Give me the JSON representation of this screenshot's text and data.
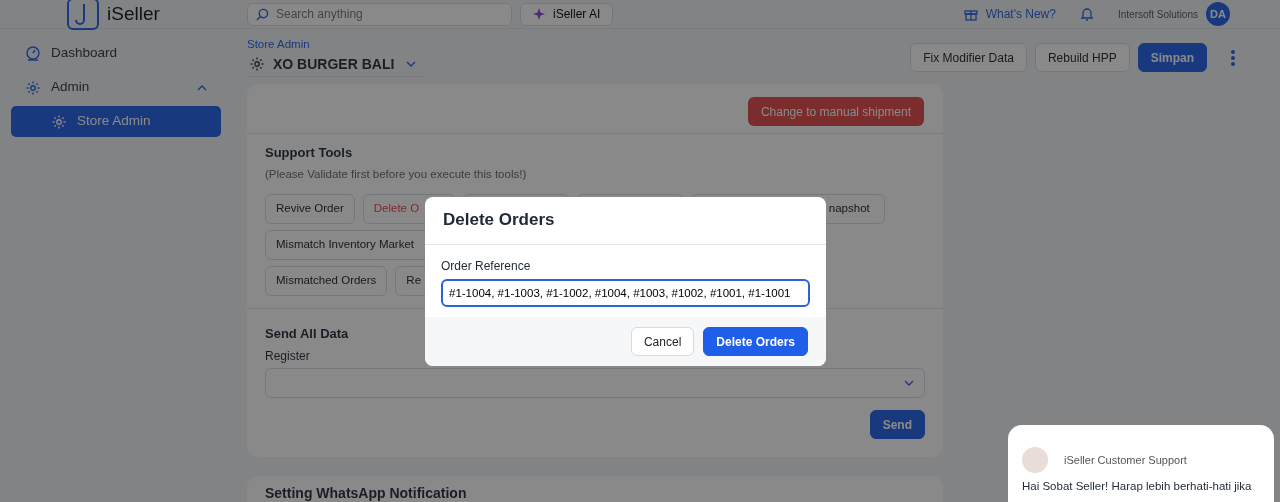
{
  "header": {
    "logo_text": "iSeller",
    "search": {
      "placeholder": "Search anything"
    },
    "ai_button": "iSeller AI",
    "whats_new": "What's New?",
    "company": "Intersoft Solutions",
    "avatar": "DA"
  },
  "sidebar": {
    "items": [
      {
        "label": "Dashboard",
        "kind": "dashboard",
        "selected": false
      },
      {
        "label": "Admin",
        "kind": "gear",
        "selected": false,
        "expanded": true,
        "children": [
          {
            "label": "Store Admin",
            "kind": "gear",
            "selected": true
          }
        ]
      }
    ]
  },
  "page": {
    "breadcrumb": "Store Admin",
    "store_name": "XO BURGER BALI",
    "actions": [
      {
        "label": "Fix Modifier Data",
        "kind": "secondary"
      },
      {
        "label": "Rebuild HPP",
        "kind": "secondary"
      },
      {
        "label": "Simpan",
        "kind": "primary"
      }
    ]
  },
  "shipment_button": "Change to manual shipment",
  "support_tools": {
    "title": "Support Tools",
    "note": "(Please Validate first before you execute this tools!)",
    "rows": [
      [
        {
          "kind": "full",
          "label": "Revive Order"
        },
        {
          "kind": "danger",
          "label": "Delete O"
        },
        {
          "kind": "covered"
        },
        {
          "kind": "covered"
        },
        {
          "kind": "tail",
          "label": "napshot"
        }
      ],
      [
        {
          "kind": "cut",
          "label": "Mismatch Inventory Market"
        }
      ],
      [
        {
          "kind": "full",
          "label": "Mismatched Orders"
        },
        {
          "kind": "cut",
          "label": "Re"
        }
      ]
    ]
  },
  "send_all_data": {
    "title": "Send All Data",
    "field_label": "Register",
    "button": "Send"
  },
  "next_card": {
    "title": "Setting WhatsApp Notification"
  },
  "modal": {
    "title": "Delete Orders",
    "field_label": "Order Reference",
    "value": "#1-1004, #1-1003, #1-1002, #1004, #1003, #1002, #1001, #1-1001",
    "buttons": [
      {
        "label": "Cancel",
        "kind": "secondary"
      },
      {
        "label": "Delete Orders",
        "kind": "primary"
      }
    ]
  },
  "chat": {
    "sender": "iSeller Customer Support",
    "message": "Hai Sobat Seller! Harap lebih berhati-hati jika"
  }
}
